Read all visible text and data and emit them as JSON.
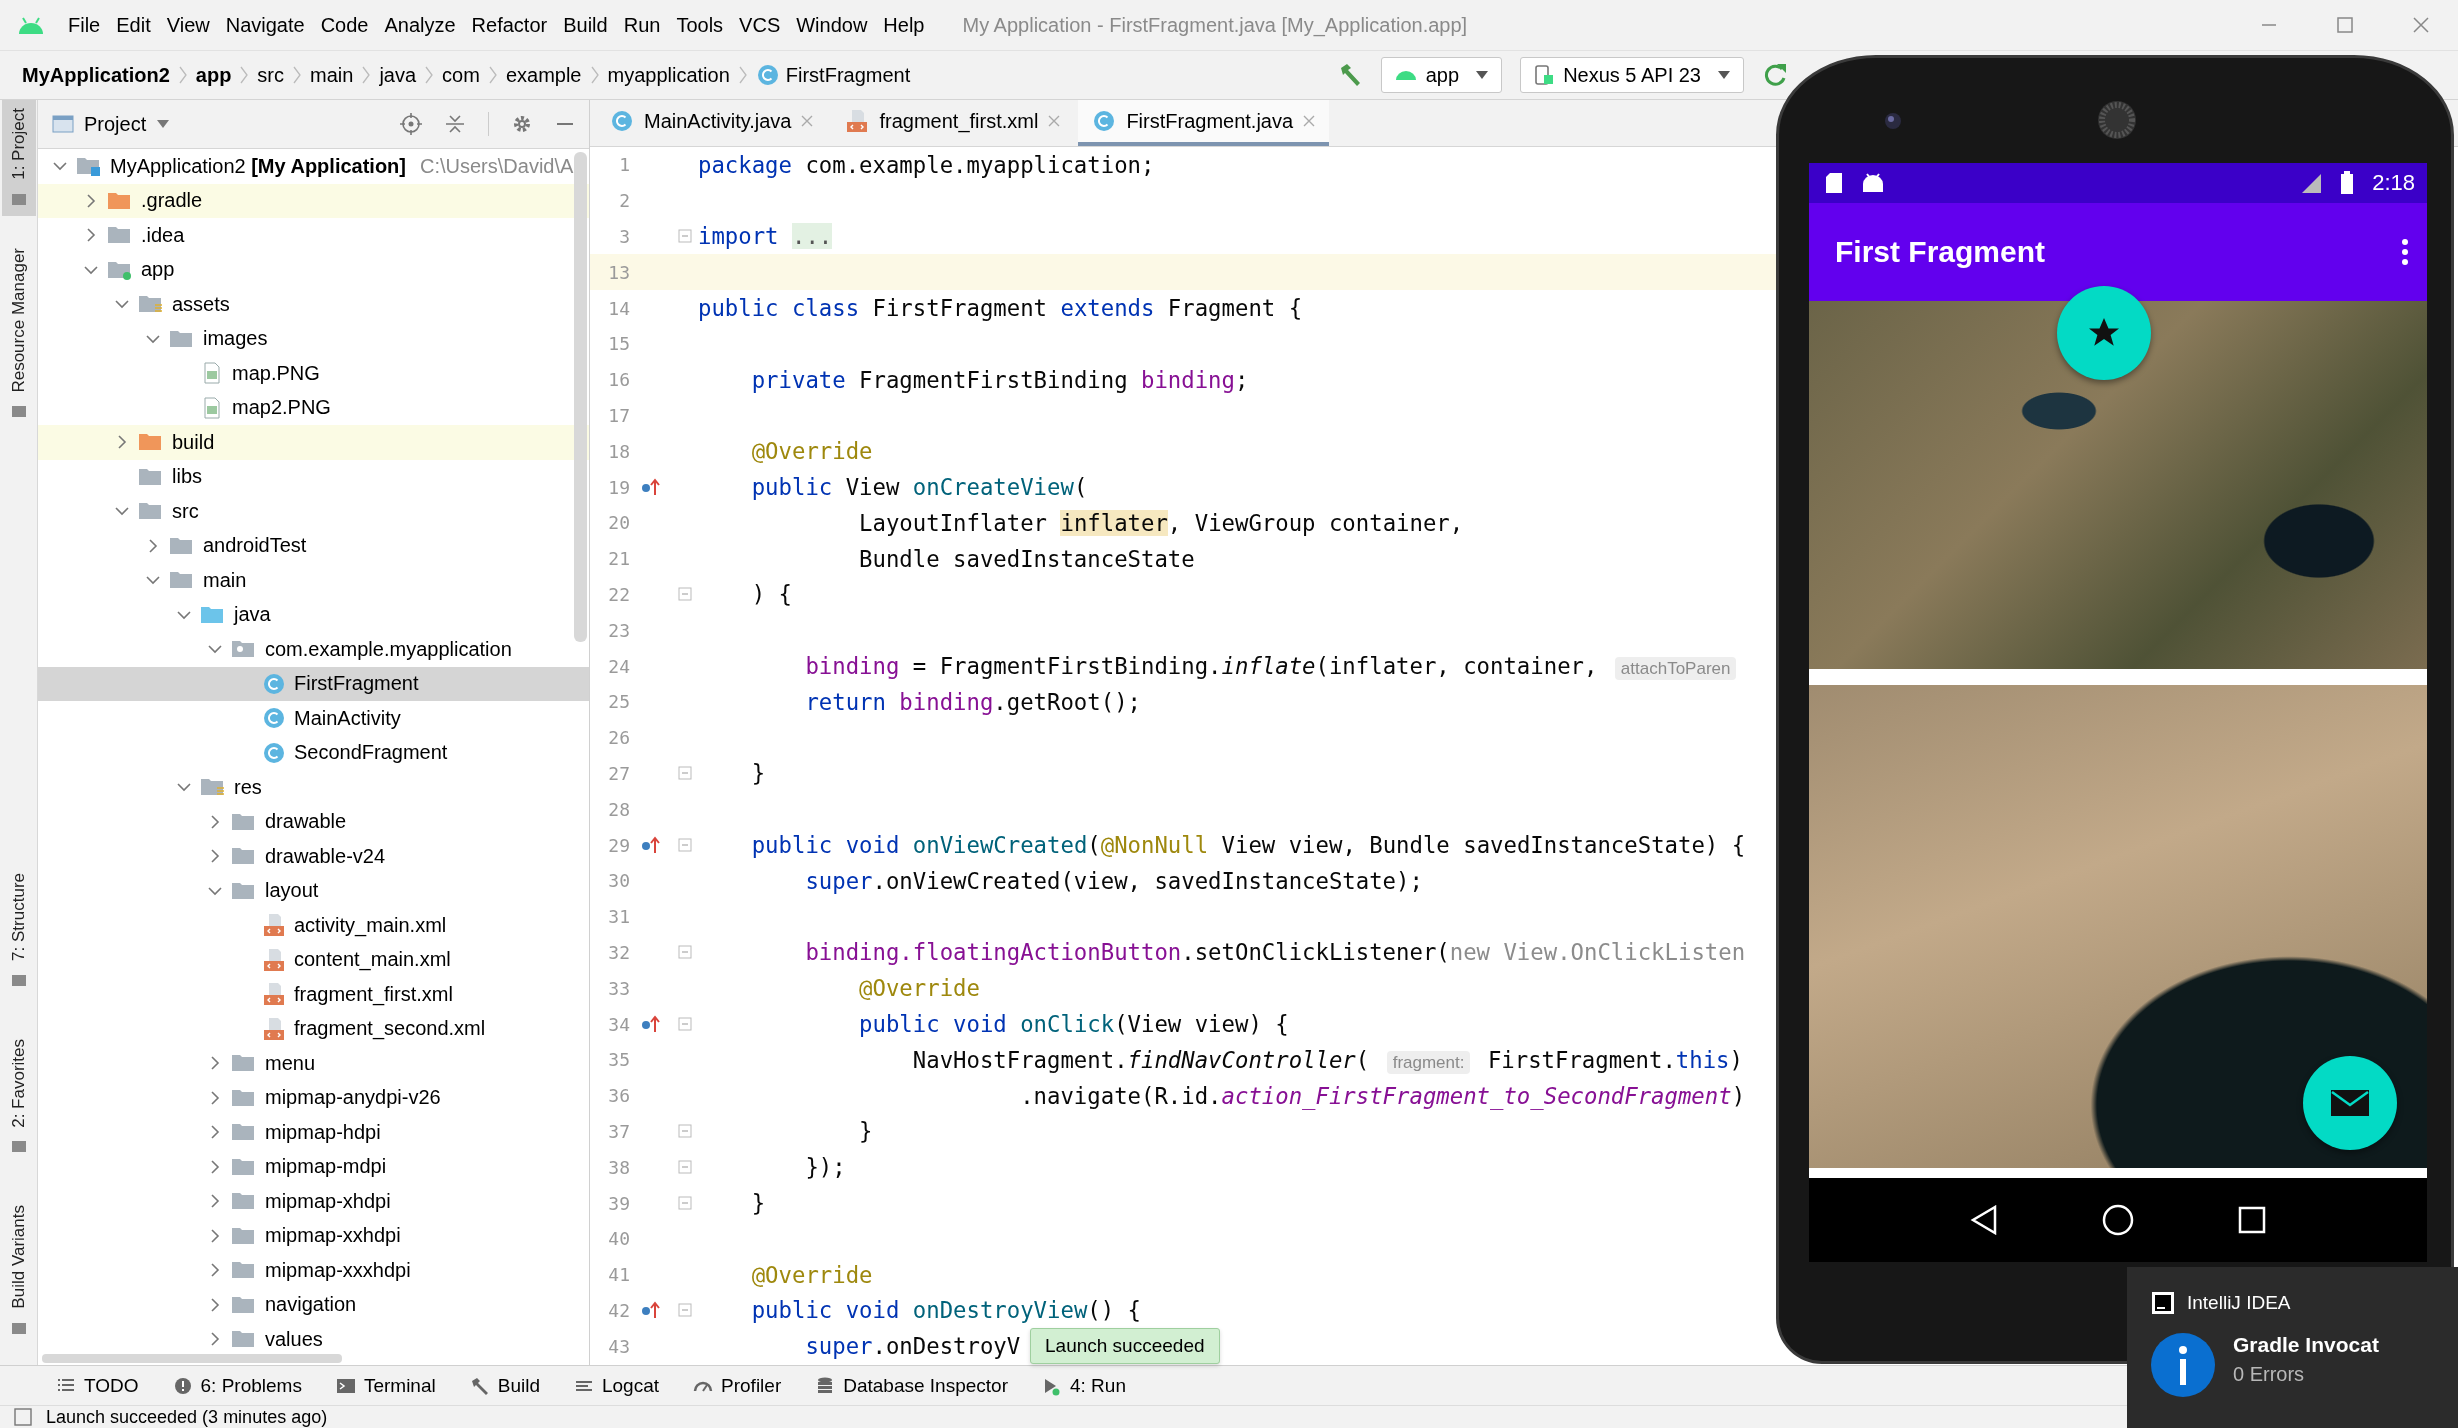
{
  "menu_bar": {
    "menus": [
      "File",
      "Edit",
      "View",
      "Navigate",
      "Code",
      "Analyze",
      "Refactor",
      "Build",
      "Run",
      "Tools",
      "VCS",
      "Window",
      "Help"
    ],
    "title": "My Application - FirstFragment.java [My_Application.app]"
  },
  "nav_bar": {
    "breadcrumbs": [
      {
        "label": "MyApplication2",
        "bold": true,
        "kind": "folder"
      },
      {
        "label": "app",
        "bold": true,
        "kind": "folder"
      },
      {
        "label": "src",
        "bold": false,
        "kind": "folder"
      },
      {
        "label": "main",
        "bold": false,
        "kind": "folder"
      },
      {
        "label": "java",
        "bold": false,
        "kind": "folder"
      },
      {
        "label": "com",
        "bold": false,
        "kind": "folder"
      },
      {
        "label": "example",
        "bold": false,
        "kind": "folder"
      },
      {
        "label": "myapplication",
        "bold": false,
        "kind": "folder"
      },
      {
        "label": "FirstFragment",
        "bold": false,
        "kind": "class"
      }
    ],
    "run_config": "app",
    "device": "Nexus 5 API 23"
  },
  "side_tabs": [
    {
      "label": "1: Project",
      "selected": true
    },
    {
      "label": "Resource Manager",
      "selected": false
    },
    {
      "label": "7: Structure",
      "selected": false
    },
    {
      "label": "2: Favorites",
      "selected": false
    },
    {
      "label": "Build Variants",
      "selected": false
    }
  ],
  "project_panel": {
    "title": "Project",
    "tree": [
      {
        "label": "MyApplication2 **[My Application]**",
        "path": "C:\\Users\\David\\A",
        "kind": "module-root",
        "expanded": true,
        "selected": false,
        "children": [
          {
            "label": ".gradle",
            "kind": "excluded-folder",
            "expanded": false,
            "selected": false
          },
          {
            "label": ".idea",
            "kind": "folder",
            "expanded": false,
            "selected": false
          },
          {
            "label": "app",
            "kind": "module",
            "expanded": true,
            "selected": false,
            "children": [
              {
                "label": "assets",
                "kind": "resource-folder",
                "expanded": true,
                "selected": false,
                "children": [
                  {
                    "label": "images",
                    "kind": "folder",
                    "expanded": true,
                    "selected": false,
                    "children": [
                      {
                        "label": "map.PNG",
                        "kind": "image",
                        "selected": false
                      },
                      {
                        "label": "map2.PNG",
                        "kind": "image",
                        "selected": false
                      }
                    ]
                  }
                ]
              },
              {
                "label": "build",
                "kind": "excluded-folder",
                "expanded": false,
                "selected": false
              },
              {
                "label": "libs",
                "kind": "folder",
                "selected": false
              },
              {
                "label": "src",
                "kind": "folder",
                "expanded": true,
                "selected": false,
                "children": [
                  {
                    "label": "androidTest",
                    "kind": "folder",
                    "expanded": false,
                    "selected": false
                  },
                  {
                    "label": "main",
                    "kind": "folder",
                    "expanded": true,
                    "selected": false,
                    "children": [
                      {
                        "label": "java",
                        "kind": "source-folder",
                        "expanded": true,
                        "selected": false,
                        "children": [
                          {
                            "label": "com.example.myapplication",
                            "kind": "package",
                            "expanded": true,
                            "selected": false,
                            "children": [
                              {
                                "label": "FirstFragment",
                                "kind": "class",
                                "selected": true
                              },
                              {
                                "label": "MainActivity",
                                "kind": "class",
                                "selected": false
                              },
                              {
                                "label": "SecondFragment",
                                "kind": "class",
                                "selected": false
                              }
                            ]
                          }
                        ]
                      },
                      {
                        "label": "res",
                        "kind": "resource-folder",
                        "expanded": true,
                        "selected": false,
                        "children": [
                          {
                            "label": "drawable",
                            "kind": "folder",
                            "expanded": false,
                            "selected": false
                          },
                          {
                            "label": "drawable-v24",
                            "kind": "folder",
                            "expanded": false,
                            "selected": false
                          },
                          {
                            "label": "layout",
                            "kind": "folder",
                            "expanded": true,
                            "selected": false,
                            "children": [
                              {
                                "label": "activity_main.xml",
                                "kind": "xml",
                                "selected": false
                              },
                              {
                                "label": "content_main.xml",
                                "kind": "xml",
                                "selected": false
                              },
                              {
                                "label": "fragment_first.xml",
                                "kind": "xml",
                                "selected": false
                              },
                              {
                                "label": "fragment_second.xml",
                                "kind": "xml",
                                "selected": false
                              }
                            ]
                          },
                          {
                            "label": "menu",
                            "kind": "folder",
                            "expanded": false,
                            "selected": false
                          },
                          {
                            "label": "mipmap-anydpi-v26",
                            "kind": "folder",
                            "expanded": false,
                            "selected": false
                          },
                          {
                            "label": "mipmap-hdpi",
                            "kind": "folder",
                            "expanded": false,
                            "selected": false
                          },
                          {
                            "label": "mipmap-mdpi",
                            "kind": "folder",
                            "expanded": false,
                            "selected": false
                          },
                          {
                            "label": "mipmap-xhdpi",
                            "kind": "folder",
                            "expanded": false,
                            "selected": false
                          },
                          {
                            "label": "mipmap-xxhdpi",
                            "kind": "folder",
                            "expanded": false,
                            "selected": false
                          },
                          {
                            "label": "mipmap-xxxhdpi",
                            "kind": "folder",
                            "expanded": false,
                            "selected": false
                          },
                          {
                            "label": "navigation",
                            "kind": "folder",
                            "expanded": false,
                            "selected": false
                          },
                          {
                            "label": "values",
                            "kind": "folder",
                            "expanded": false,
                            "selected": false
                          }
                        ]
                      }
                    ]
                  }
                ]
              }
            ]
          }
        ]
      }
    ]
  },
  "editor": {
    "tabs": [
      {
        "label": "MainActivity.java",
        "kind": "class",
        "selected": false
      },
      {
        "label": "fragment_first.xml",
        "kind": "xml",
        "selected": false
      },
      {
        "label": "FirstFragment.java",
        "kind": "class",
        "selected": true
      }
    ],
    "lines": [
      {
        "number": "1",
        "current": false,
        "override_marker": false,
        "fold_marker": false,
        "segments": [
          {
            "text": "package",
            "kind": "keyword"
          },
          {
            "text": " com.example.myapplication;",
            "kind": "plain"
          }
        ]
      },
      {
        "number": "2",
        "current": false,
        "override_marker": false,
        "fold_marker": false
      },
      {
        "number": "3",
        "current": false,
        "override_marker": false,
        "fold_marker": true,
        "segments": [
          {
            "text": "import ",
            "kind": "keyword"
          },
          {
            "text": "...",
            "kind": "folded"
          }
        ]
      },
      {
        "number": "13",
        "current": true,
        "override_marker": false,
        "fold_marker": false
      },
      {
        "number": "14",
        "current": false,
        "override_marker": false,
        "fold_marker": false,
        "segments": [
          {
            "text": "public class",
            "kind": "keyword"
          },
          {
            "text": " FirstFragment ",
            "kind": "plain"
          },
          {
            "text": "extends",
            "kind": "keyword"
          },
          {
            "text": " Fragment {",
            "kind": "plain"
          }
        ]
      },
      {
        "number": "15",
        "current": false,
        "override_marker": false,
        "fold_marker": false
      },
      {
        "number": "16",
        "current": false,
        "override_marker": false,
        "fold_marker": false,
        "segments": [
          {
            "text": "    private",
            "kind": "keyword"
          },
          {
            "text": " FragmentFirstBinding ",
            "kind": "plain"
          },
          {
            "text": "binding",
            "kind": "field"
          },
          {
            "text": ";",
            "kind": "plain"
          }
        ]
      },
      {
        "number": "17",
        "current": false,
        "override_marker": false,
        "fold_marker": false
      },
      {
        "number": "18",
        "current": false,
        "override_marker": false,
        "fold_marker": false,
        "segments": [
          {
            "text": "    @Override",
            "kind": "annotation"
          }
        ]
      },
      {
        "number": "19",
        "current": false,
        "override_marker": true,
        "fold_marker": false,
        "segments": [
          {
            "text": "    public",
            "kind": "keyword"
          },
          {
            "text": " View ",
            "kind": "plain"
          },
          {
            "text": "onCreateView",
            "kind": "method"
          },
          {
            "text": "(",
            "kind": "plain"
          }
        ]
      },
      {
        "number": "20",
        "current": false,
        "override_marker": false,
        "fold_marker": false,
        "segments": [
          {
            "text": "            LayoutInflater ",
            "kind": "plain"
          },
          {
            "text": "inflater",
            "kind": "highlight"
          },
          {
            "text": ", ViewGroup container,",
            "kind": "plain"
          }
        ]
      },
      {
        "number": "21",
        "current": false,
        "override_marker": false,
        "fold_marker": false,
        "segments": [
          {
            "text": "            Bundle savedInstanceState",
            "kind": "plain"
          }
        ]
      },
      {
        "number": "22",
        "current": false,
        "override_marker": false,
        "fold_marker": true,
        "segments": [
          {
            "text": "    ) {",
            "kind": "plain"
          }
        ]
      },
      {
        "number": "23",
        "current": false,
        "override_marker": false,
        "fold_marker": false
      },
      {
        "number": "24",
        "current": false,
        "override_marker": false,
        "fold_marker": false,
        "segments": [
          {
            "text": "        binding",
            "kind": "field"
          },
          {
            "text": " = FragmentFirstBinding.",
            "kind": "plain"
          },
          {
            "text": "inflate",
            "kind": "static"
          },
          {
            "text": "(inflater, container, ",
            "kind": "plain"
          },
          {
            "text": "attachToParen",
            "kind": "hint"
          }
        ]
      },
      {
        "number": "25",
        "current": false,
        "override_marker": false,
        "fold_marker": false,
        "segments": [
          {
            "text": "        return ",
            "kind": "keyword"
          },
          {
            "text": "binding",
            "kind": "field"
          },
          {
            "text": ".getRoot();",
            "kind": "plain"
          }
        ]
      },
      {
        "number": "26",
        "current": false,
        "override_marker": false,
        "fold_marker": false
      },
      {
        "number": "27",
        "current": false,
        "override_marker": false,
        "fold_marker": true,
        "segments": [
          {
            "text": "    }",
            "kind": "plain"
          }
        ]
      },
      {
        "number": "28",
        "current": false,
        "override_marker": false,
        "fold_marker": false
      },
      {
        "number": "29",
        "current": false,
        "override_marker": true,
        "fold_marker": true,
        "segments": [
          {
            "text": "    public void ",
            "kind": "keyword"
          },
          {
            "text": "onViewCreated",
            "kind": "method"
          },
          {
            "text": "(",
            "kind": "plain"
          },
          {
            "text": "@NonNull",
            "kind": "annotation"
          },
          {
            "text": " View view, Bundle savedInstanceState) {",
            "kind": "plain"
          }
        ]
      },
      {
        "number": "30",
        "current": false,
        "override_marker": false,
        "fold_marker": false,
        "segments": [
          {
            "text": "        super",
            "kind": "keyword"
          },
          {
            "text": ".onViewCreated(view, savedInstanceState);",
            "kind": "plain"
          }
        ]
      },
      {
        "number": "31",
        "current": false,
        "override_marker": false,
        "fold_marker": false
      },
      {
        "number": "32",
        "current": false,
        "override_marker": false,
        "fold_marker": true,
        "segments": [
          {
            "text": "        binding.floatingActionButton",
            "kind": "field"
          },
          {
            "text": ".setOnClickListener(",
            "kind": "plain"
          },
          {
            "text": "new View.OnClickListen",
            "kind": "dim"
          }
        ]
      },
      {
        "number": "33",
        "current": false,
        "override_marker": false,
        "fold_marker": false,
        "segments": [
          {
            "text": "            @Override",
            "kind": "annotation"
          }
        ]
      },
      {
        "number": "34",
        "current": false,
        "override_marker": true,
        "fold_marker": true,
        "segments": [
          {
            "text": "            public void ",
            "kind": "keyword"
          },
          {
            "text": "onClick",
            "kind": "method"
          },
          {
            "text": "(View view) {",
            "kind": "plain"
          }
        ]
      },
      {
        "number": "35",
        "current": false,
        "override_marker": false,
        "fold_marker": false,
        "segments": [
          {
            "text": "                NavHostFragment.",
            "kind": "plain"
          },
          {
            "text": "findNavController",
            "kind": "static"
          },
          {
            "text": "( ",
            "kind": "plain"
          },
          {
            "text": "fragment:",
            "kind": "hint"
          },
          {
            "text": " FirstFragment.",
            "kind": "plain"
          },
          {
            "text": "this",
            "kind": "keyword"
          },
          {
            "text": ")",
            "kind": "plain"
          }
        ]
      },
      {
        "number": "36",
        "current": false,
        "override_marker": false,
        "fold_marker": false,
        "segments": [
          {
            "text": "                        .navigate(R.id.",
            "kind": "plain"
          },
          {
            "text": "action_FirstFragment_to_SecondFragment",
            "kind": "constant"
          },
          {
            "text": ")",
            "kind": "plain"
          }
        ]
      },
      {
        "number": "37",
        "current": false,
        "override_marker": false,
        "fold_marker": true,
        "segments": [
          {
            "text": "            }",
            "kind": "plain"
          }
        ]
      },
      {
        "number": "38",
        "current": false,
        "override_marker": false,
        "fold_marker": true,
        "segments": [
          {
            "text": "        });",
            "kind": "plain"
          }
        ]
      },
      {
        "number": "39",
        "current": false,
        "override_marker": false,
        "fold_marker": true,
        "segments": [
          {
            "text": "    }",
            "kind": "plain"
          }
        ]
      },
      {
        "number": "40",
        "current": false,
        "override_marker": false,
        "fold_marker": false
      },
      {
        "number": "41",
        "current": false,
        "override_marker": false,
        "fold_marker": false,
        "segments": [
          {
            "text": "    @Override",
            "kind": "annotation"
          }
        ]
      },
      {
        "number": "42",
        "current": false,
        "override_marker": true,
        "fold_marker": true,
        "segments": [
          {
            "text": "    public void ",
            "kind": "keyword"
          },
          {
            "text": "onDestroyView",
            "kind": "method"
          },
          {
            "text": "() {",
            "kind": "plain"
          }
        ]
      },
      {
        "number": "43",
        "current": false,
        "override_marker": false,
        "fold_marker": false,
        "segments": [
          {
            "text": "        super",
            "kind": "keyword"
          },
          {
            "text": ".onDestroyV",
            "kind": "plain"
          }
        ]
      }
    ]
  },
  "emulator": {
    "time": "2:18",
    "app_title": "First Fragment"
  },
  "tooltip": "Launch succeeded",
  "bottom_tools": [
    {
      "label": "TODO",
      "kind": "todo"
    },
    {
      "label": "6: Problems",
      "kind": "problems"
    },
    {
      "label": "Terminal",
      "kind": "terminal"
    },
    {
      "label": "Build",
      "kind": "build"
    },
    {
      "label": "Logcat",
      "kind": "logcat"
    },
    {
      "label": "Profiler",
      "kind": "profiler"
    },
    {
      "label": "Database Inspector",
      "kind": "database"
    },
    {
      "label": "4: Run",
      "kind": "run"
    }
  ],
  "status": "Launch succeeded (3 minutes ago)",
  "notification": {
    "app": "IntelliJ IDEA",
    "title": "Gradle Invocat",
    "body": "0 Errors"
  }
}
